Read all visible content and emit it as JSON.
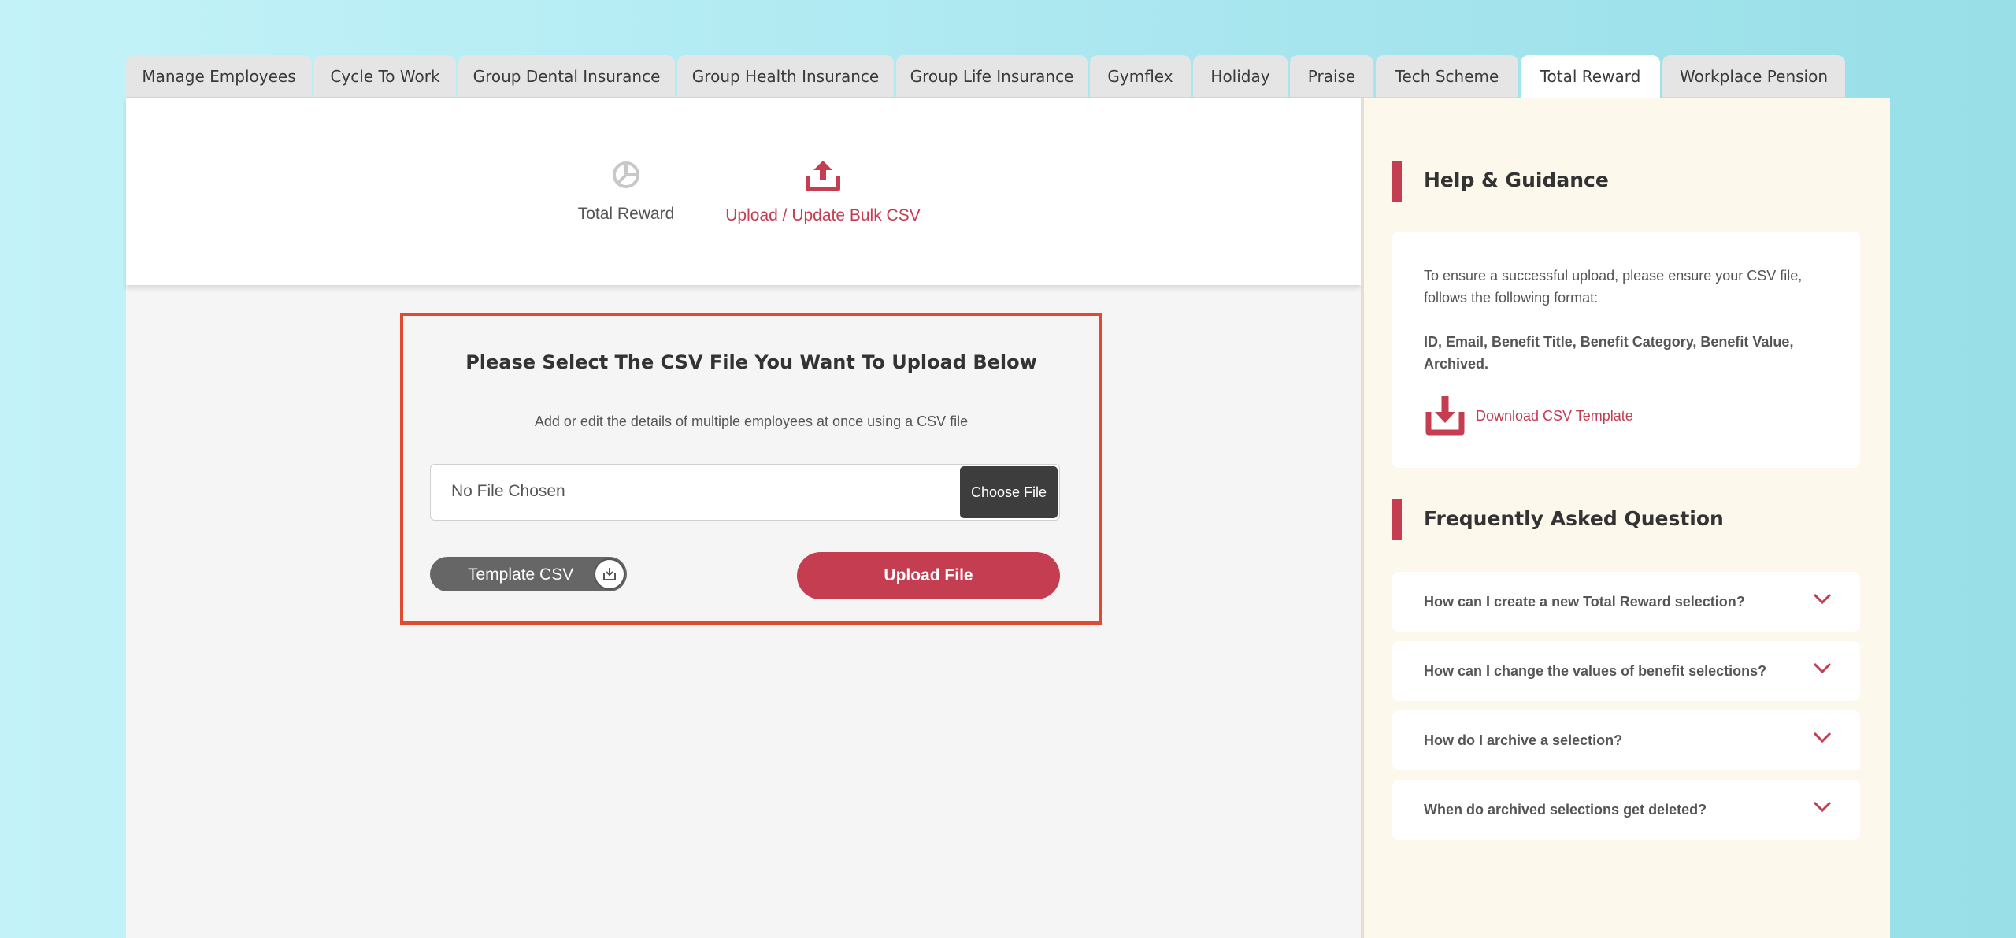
{
  "tabs": [
    {
      "label": "Manage Employees",
      "active": false
    },
    {
      "label": "Cycle To Work",
      "active": false
    },
    {
      "label": "Group Dental Insurance",
      "active": false
    },
    {
      "label": "Group Health Insurance",
      "active": false
    },
    {
      "label": "Group Life Insurance",
      "active": false
    },
    {
      "label": "Gymflex",
      "active": false
    },
    {
      "label": "Holiday",
      "active": false
    },
    {
      "label": "Praise",
      "active": false
    },
    {
      "label": "Tech Scheme",
      "active": false
    },
    {
      "label": "Total Reward",
      "active": true
    },
    {
      "label": "Workplace Pension",
      "active": false
    }
  ],
  "subnav": {
    "items": [
      {
        "label": "Total Reward",
        "icon": "pie-chart-icon",
        "active": false
      },
      {
        "label": "Upload / Update Bulk CSV",
        "icon": "upload-icon",
        "active": true
      }
    ]
  },
  "upload": {
    "title": "Please Select The CSV File You Want To Upload Below",
    "subtitle": "Add or edit the details of multiple employees at once using a CSV file",
    "file_placeholder": "No File Chosen",
    "choose_label": "Choose File",
    "template_label": "Template CSV",
    "upload_label": "Upload File"
  },
  "help": {
    "title": "Help & Guidance",
    "text": "To ensure a successful upload, please ensure your CSV file, follows the following format:",
    "format": "ID, Email, Benefit Title, Benefit Category, Benefit Value, Archived.",
    "download_label": "Download CSV Template"
  },
  "faq": {
    "title": "Frequently Asked Question",
    "items": [
      "How can I create a new Total Reward selection?",
      "How can I change the values of benefit selections?",
      "How do I archive a selection?",
      "When do archived selections get deleted?"
    ]
  },
  "colors": {
    "accent": "#c43d51",
    "highlight_border": "#e04a30",
    "sidebar_bg": "#fdf8ec"
  }
}
